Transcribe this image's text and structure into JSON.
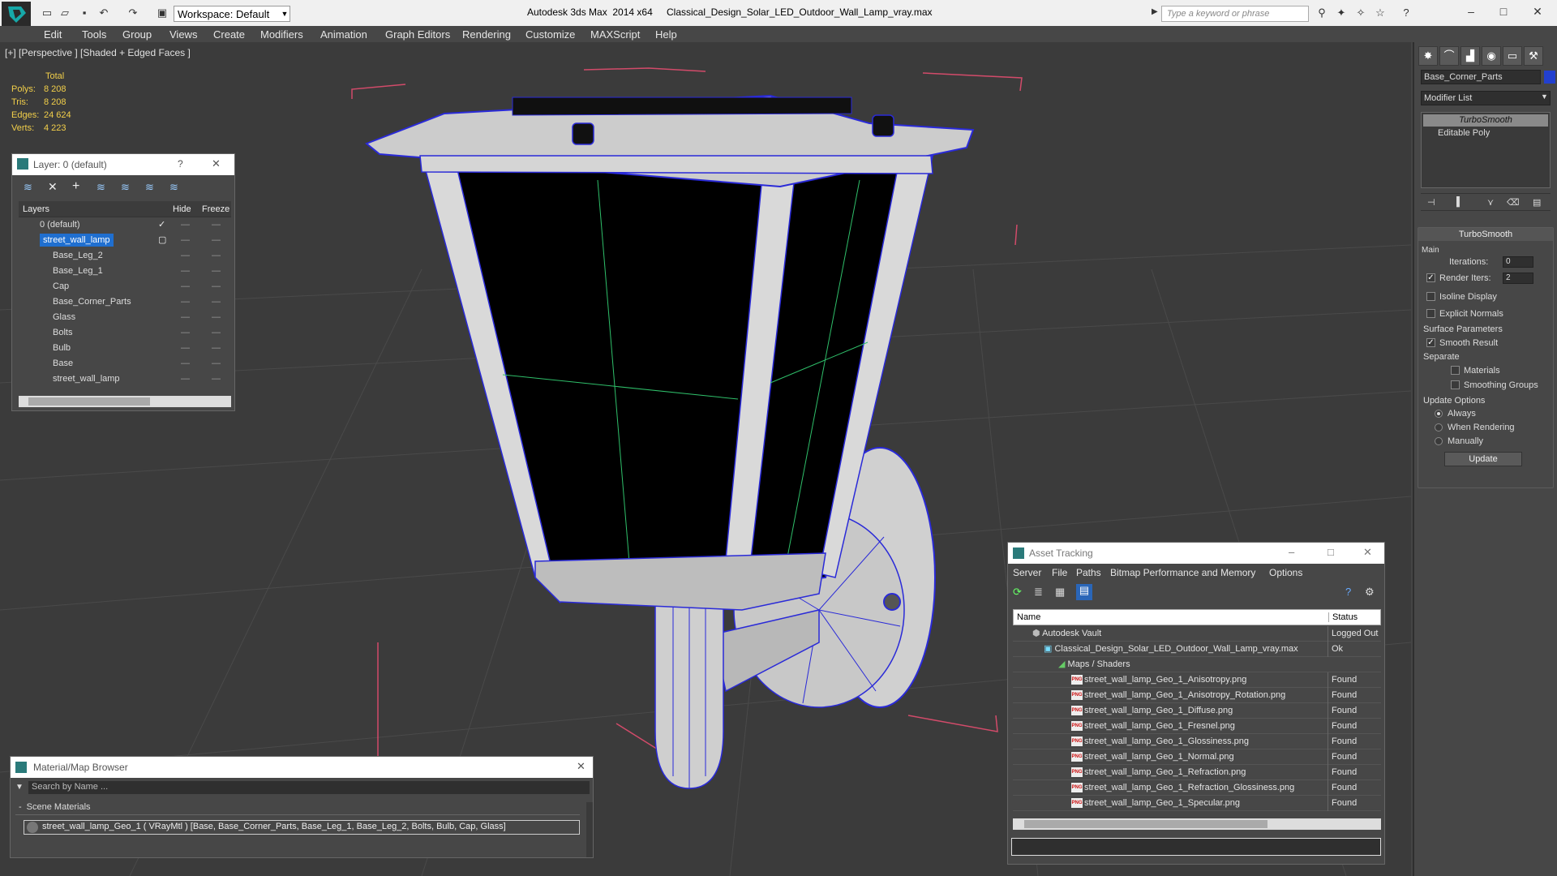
{
  "app": {
    "title": "Autodesk 3ds Max  2014 x64",
    "file_title": "Classical_Design_Solar_LED_Outdoor_Wall_Lamp_vray.max",
    "workspace": "Workspace: Default",
    "search_placeholder": "Type a keyword or phrase"
  },
  "menu": [
    "Edit",
    "Tools",
    "Group",
    "Views",
    "Create",
    "Modifiers",
    "Animation",
    "Graph Editors",
    "Rendering",
    "Customize",
    "MAXScript",
    "Help"
  ],
  "viewport": {
    "label": "[+] [Perspective ] [Shaded + Edged Faces ]",
    "stats": {
      "header": "Total",
      "rows": [
        {
          "label": "Polys:",
          "value": "8 208"
        },
        {
          "label": "Tris:",
          "value": "8 208"
        },
        {
          "label": "Edges:",
          "value": "24 624"
        },
        {
          "label": "Verts:",
          "value": "4 223"
        }
      ]
    }
  },
  "layer_dialog": {
    "title": "Layer: 0 (default)",
    "help": "?",
    "columns": {
      "layers": "Layers",
      "hide": "Hide",
      "freeze": "Freeze"
    },
    "rows": [
      {
        "name": "0 (default)"
      },
      {
        "name": "street_wall_lamp"
      },
      {
        "name": "Base_Leg_2"
      },
      {
        "name": "Base_Leg_1"
      },
      {
        "name": "Cap"
      },
      {
        "name": "Base_Corner_Parts"
      },
      {
        "name": "Glass"
      },
      {
        "name": "Bolts"
      },
      {
        "name": "Bulb"
      },
      {
        "name": "Base"
      },
      {
        "name": "street_wall_lamp"
      }
    ]
  },
  "command_panel": {
    "object_name": "Base_Corner_Parts",
    "modifier_list": "Modifier List",
    "stack": [
      "TurboSmooth",
      "Editable Poly"
    ],
    "rollout_title": "TurboSmooth",
    "main_label": "Main",
    "iterations_label": "Iterations:",
    "iterations_value": "0",
    "render_iters_label": "Render Iters:",
    "render_iters_value": "2",
    "isoline": "Isoline Display",
    "explicit_normals": "Explicit Normals",
    "surface_params": "Surface Parameters",
    "smooth_result": "Smooth Result",
    "separate": "Separate",
    "materials": "Materials",
    "smoothing_groups": "Smoothing Groups",
    "update_options": "Update Options",
    "always": "Always",
    "when_rendering": "When Rendering",
    "manually": "Manually",
    "update_btn": "Update"
  },
  "material_browser": {
    "title": "Material/Map Browser",
    "search_placeholder": "Search by Name ...",
    "group": "Scene Materials",
    "item": "street_wall_lamp_Geo_1  ( VRayMtl ) [Base, Base_Corner_Parts, Base_Leg_1, Base_Leg_2, Bolts, Bulb, Cap, Glass]"
  },
  "asset_tracking": {
    "title": "Asset Tracking",
    "menu": [
      "Server",
      "File",
      "Paths",
      "Bitmap Performance and Memory",
      "Options"
    ],
    "columns": {
      "name": "Name",
      "status": "Status"
    },
    "rows": [
      {
        "name": "Autodesk Vault",
        "status": "Logged Out"
      },
      {
        "name": "Classical_Design_Solar_LED_Outdoor_Wall_Lamp_vray.max",
        "status": "Ok"
      },
      {
        "name": "Maps / Shaders",
        "status": ""
      },
      {
        "name": "street_wall_lamp_Geo_1_Anisotropy.png",
        "status": "Found"
      },
      {
        "name": "street_wall_lamp_Geo_1_Anisotropy_Rotation.png",
        "status": "Found"
      },
      {
        "name": "street_wall_lamp_Geo_1_Diffuse.png",
        "status": "Found"
      },
      {
        "name": "street_wall_lamp_Geo_1_Fresnel.png",
        "status": "Found"
      },
      {
        "name": "street_wall_lamp_Geo_1_Glossiness.png",
        "status": "Found"
      },
      {
        "name": "street_wall_lamp_Geo_1_Normal.png",
        "status": "Found"
      },
      {
        "name": "street_wall_lamp_Geo_1_Refraction.png",
        "status": "Found"
      },
      {
        "name": "street_wall_lamp_Geo_1_Refraction_Glossiness.png",
        "status": "Found"
      },
      {
        "name": "street_wall_lamp_Geo_1_Specular.png",
        "status": "Found"
      }
    ]
  },
  "colors": {
    "accent": "#1f6fd0",
    "stats": "#f2cf4a",
    "wire": "#2a2ad8"
  }
}
